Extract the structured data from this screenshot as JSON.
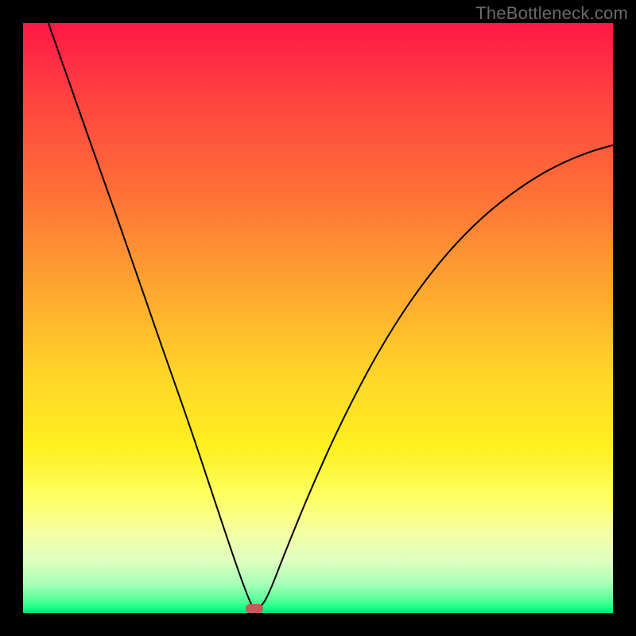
{
  "attribution": "TheBottleneck.com",
  "colors": {
    "frame_bg": "#000000",
    "curve_stroke": "#000000",
    "marker_fill": "#c65a5a",
    "gradient_top": "#ff1846",
    "gradient_bottom": "#00e878",
    "attribution_text": "#6a6a6a"
  },
  "chart_data": {
    "type": "line",
    "title": "",
    "xlabel": "",
    "ylabel": "",
    "xlim": [
      0,
      1
    ],
    "ylim": [
      0,
      1
    ],
    "note": "Axes are unlabeled percent scales; curve depicts bottleneck % vs hardware ratio with a minimum near x≈0.39 (optimal match). Values read from pixel positions.",
    "minimum_point": {
      "x": 0.392,
      "y": 0.0
    },
    "left_start": {
      "x": 0.043,
      "y": 1.0
    },
    "right_end": {
      "x": 1.0,
      "y": 0.79
    },
    "series": [
      {
        "name": "bottleneck-curve",
        "points": [
          {
            "x": 0.043,
            "y": 1.0
          },
          {
            "x": 0.09,
            "y": 0.865
          },
          {
            "x": 0.14,
            "y": 0.725
          },
          {
            "x": 0.19,
            "y": 0.583
          },
          {
            "x": 0.235,
            "y": 0.452
          },
          {
            "x": 0.28,
            "y": 0.325
          },
          {
            "x": 0.32,
            "y": 0.205
          },
          {
            "x": 0.355,
            "y": 0.1
          },
          {
            "x": 0.378,
            "y": 0.035
          },
          {
            "x": 0.392,
            "y": 0.0027
          },
          {
            "x": 0.405,
            "y": 0.012
          },
          {
            "x": 0.418,
            "y": 0.035
          },
          {
            "x": 0.445,
            "y": 0.105
          },
          {
            "x": 0.49,
            "y": 0.215
          },
          {
            "x": 0.54,
            "y": 0.325
          },
          {
            "x": 0.6,
            "y": 0.44
          },
          {
            "x": 0.66,
            "y": 0.535
          },
          {
            "x": 0.72,
            "y": 0.612
          },
          {
            "x": 0.78,
            "y": 0.673
          },
          {
            "x": 0.84,
            "y": 0.72
          },
          {
            "x": 0.9,
            "y": 0.757
          },
          {
            "x": 0.96,
            "y": 0.782
          },
          {
            "x": 1.0,
            "y": 0.793
          }
        ]
      }
    ]
  }
}
